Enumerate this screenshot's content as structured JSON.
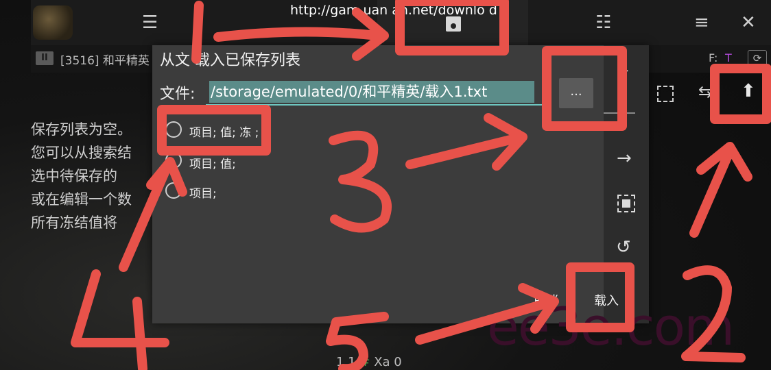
{
  "header": {
    "url_text": "http://gam   uan an.net/downlo  d"
  },
  "process_bar": {
    "pause_label": "II",
    "process_name": "[3516] 和平精英",
    "filter_label": "F:",
    "filter_value": "T",
    "refresh_label": "⟳"
  },
  "background_message": {
    "text": "保存列表为空。\n您可以从搜索结\n选中待保存的\n或在编辑一个数\n所有冻结值将"
  },
  "dialog": {
    "title": "从文  载入已保存列表",
    "file_label": "文件:",
    "file_path": "/storage/emulated/0/和平精英/载入1.txt",
    "browse_label": "...",
    "options": [
      {
        "label": "项目; 值; 冻  ;"
      },
      {
        "label": "项目; 值;"
      },
      {
        "label": "项目;"
      }
    ],
    "cancel_label": "取消",
    "load_label": "载入"
  },
  "bottom_status": {
    "count": "1  1",
    "hash": "#",
    "xa": "Xa 0"
  },
  "annotations": {
    "watermark": "ee3e.com",
    "color": "#e8524a"
  }
}
